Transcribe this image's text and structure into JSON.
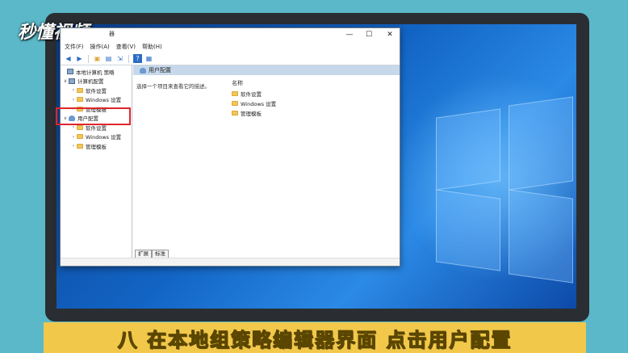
{
  "logo": "秒懂视频",
  "window": {
    "title_fragment": "器",
    "buttons": {
      "minimize": "—",
      "maximize": "☐",
      "close": "✕"
    }
  },
  "menu": [
    "文件(F)",
    "操作(A)",
    "查看(V)",
    "帮助(H)"
  ],
  "tree": {
    "root": "本地计算机 策略",
    "computer_config": "计算机配置",
    "computer_children": [
      "软件设置",
      "Windows 设置",
      "管理模板"
    ],
    "user_config": "用户配置",
    "user_children": [
      "软件设置",
      "Windows 设置",
      "管理模板"
    ]
  },
  "content": {
    "header": "用户配置",
    "description": "选择一个项目来查看它的描述。",
    "column_name": "名称",
    "items": [
      "软件设置",
      "Windows 设置",
      "管理模板"
    ],
    "tabs": [
      "扩展",
      "标准"
    ]
  },
  "caption": "八  在本地组策略编辑器界面  点击用户配置",
  "colors": {
    "highlight": "#e0262c",
    "caption_bg": "#f2c84b"
  }
}
